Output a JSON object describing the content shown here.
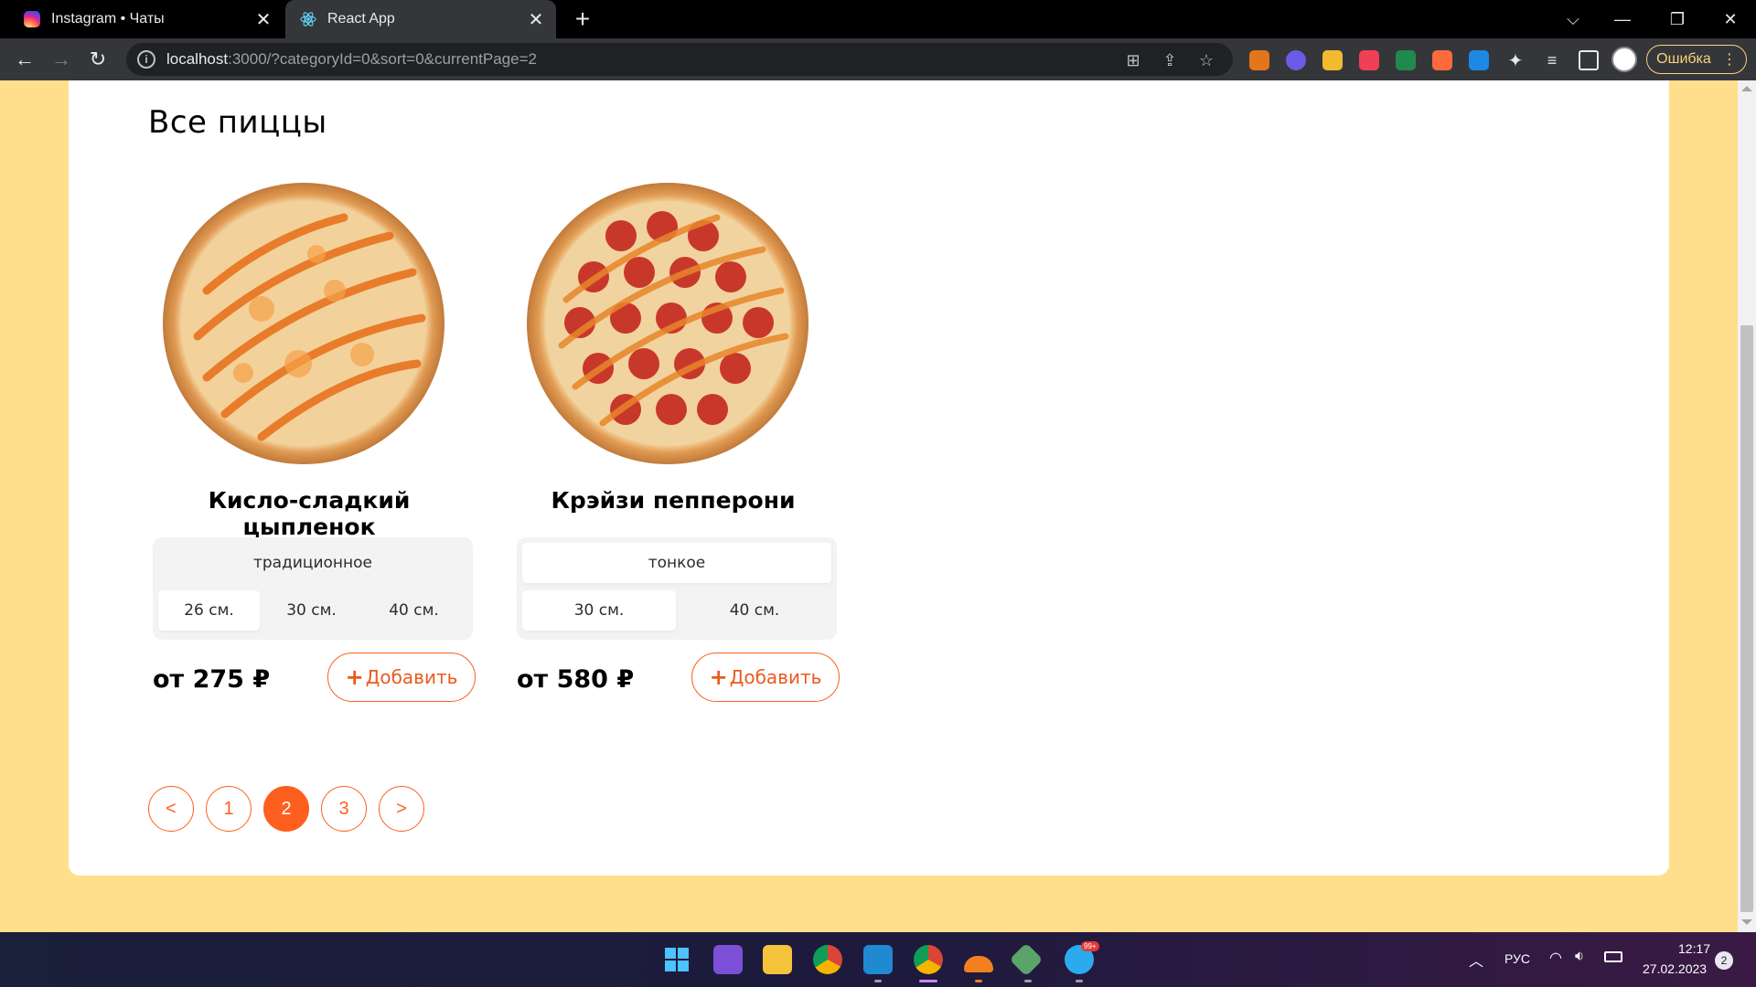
{
  "browser": {
    "tabs": [
      {
        "title": "Instagram • Чаты",
        "favicon": "instagram-icon",
        "active": false
      },
      {
        "title": "React App",
        "favicon": "react-icon",
        "active": true
      }
    ],
    "url_host": "localhost",
    "url_rest": ":3000/?categoryId=0&sort=0&currentPage=2",
    "error_button": "Ошибка"
  },
  "page": {
    "heading": "Все пиццы",
    "pizzas": [
      {
        "title": "Кисло-сладкий цыпленок",
        "types": [
          "традиционное"
        ],
        "active_type": "традиционное",
        "sizes": [
          "26 см.",
          "30 см.",
          "40 см."
        ],
        "active_size": "26 см.",
        "price": "от 275 ₽",
        "add_label": "Добавить"
      },
      {
        "title": "Крэйзи пепперони",
        "types": [
          "тонкое"
        ],
        "active_type": "тонкое",
        "sizes": [
          "30 см.",
          "40 см."
        ],
        "active_size": "30 см.",
        "price": "от 580 ₽",
        "add_label": "Добавить"
      }
    ],
    "pagination": {
      "prev": "<",
      "pages": [
        "1",
        "2",
        "3"
      ],
      "current": "2",
      "next": ">"
    },
    "colors": {
      "accent": "#fe5f1e",
      "background": "#ffdf8c"
    }
  },
  "taskbar": {
    "language": "РУС",
    "time": "12:17",
    "date": "27.02.2023",
    "notification_count": "2",
    "telegram_badge": "99+"
  }
}
